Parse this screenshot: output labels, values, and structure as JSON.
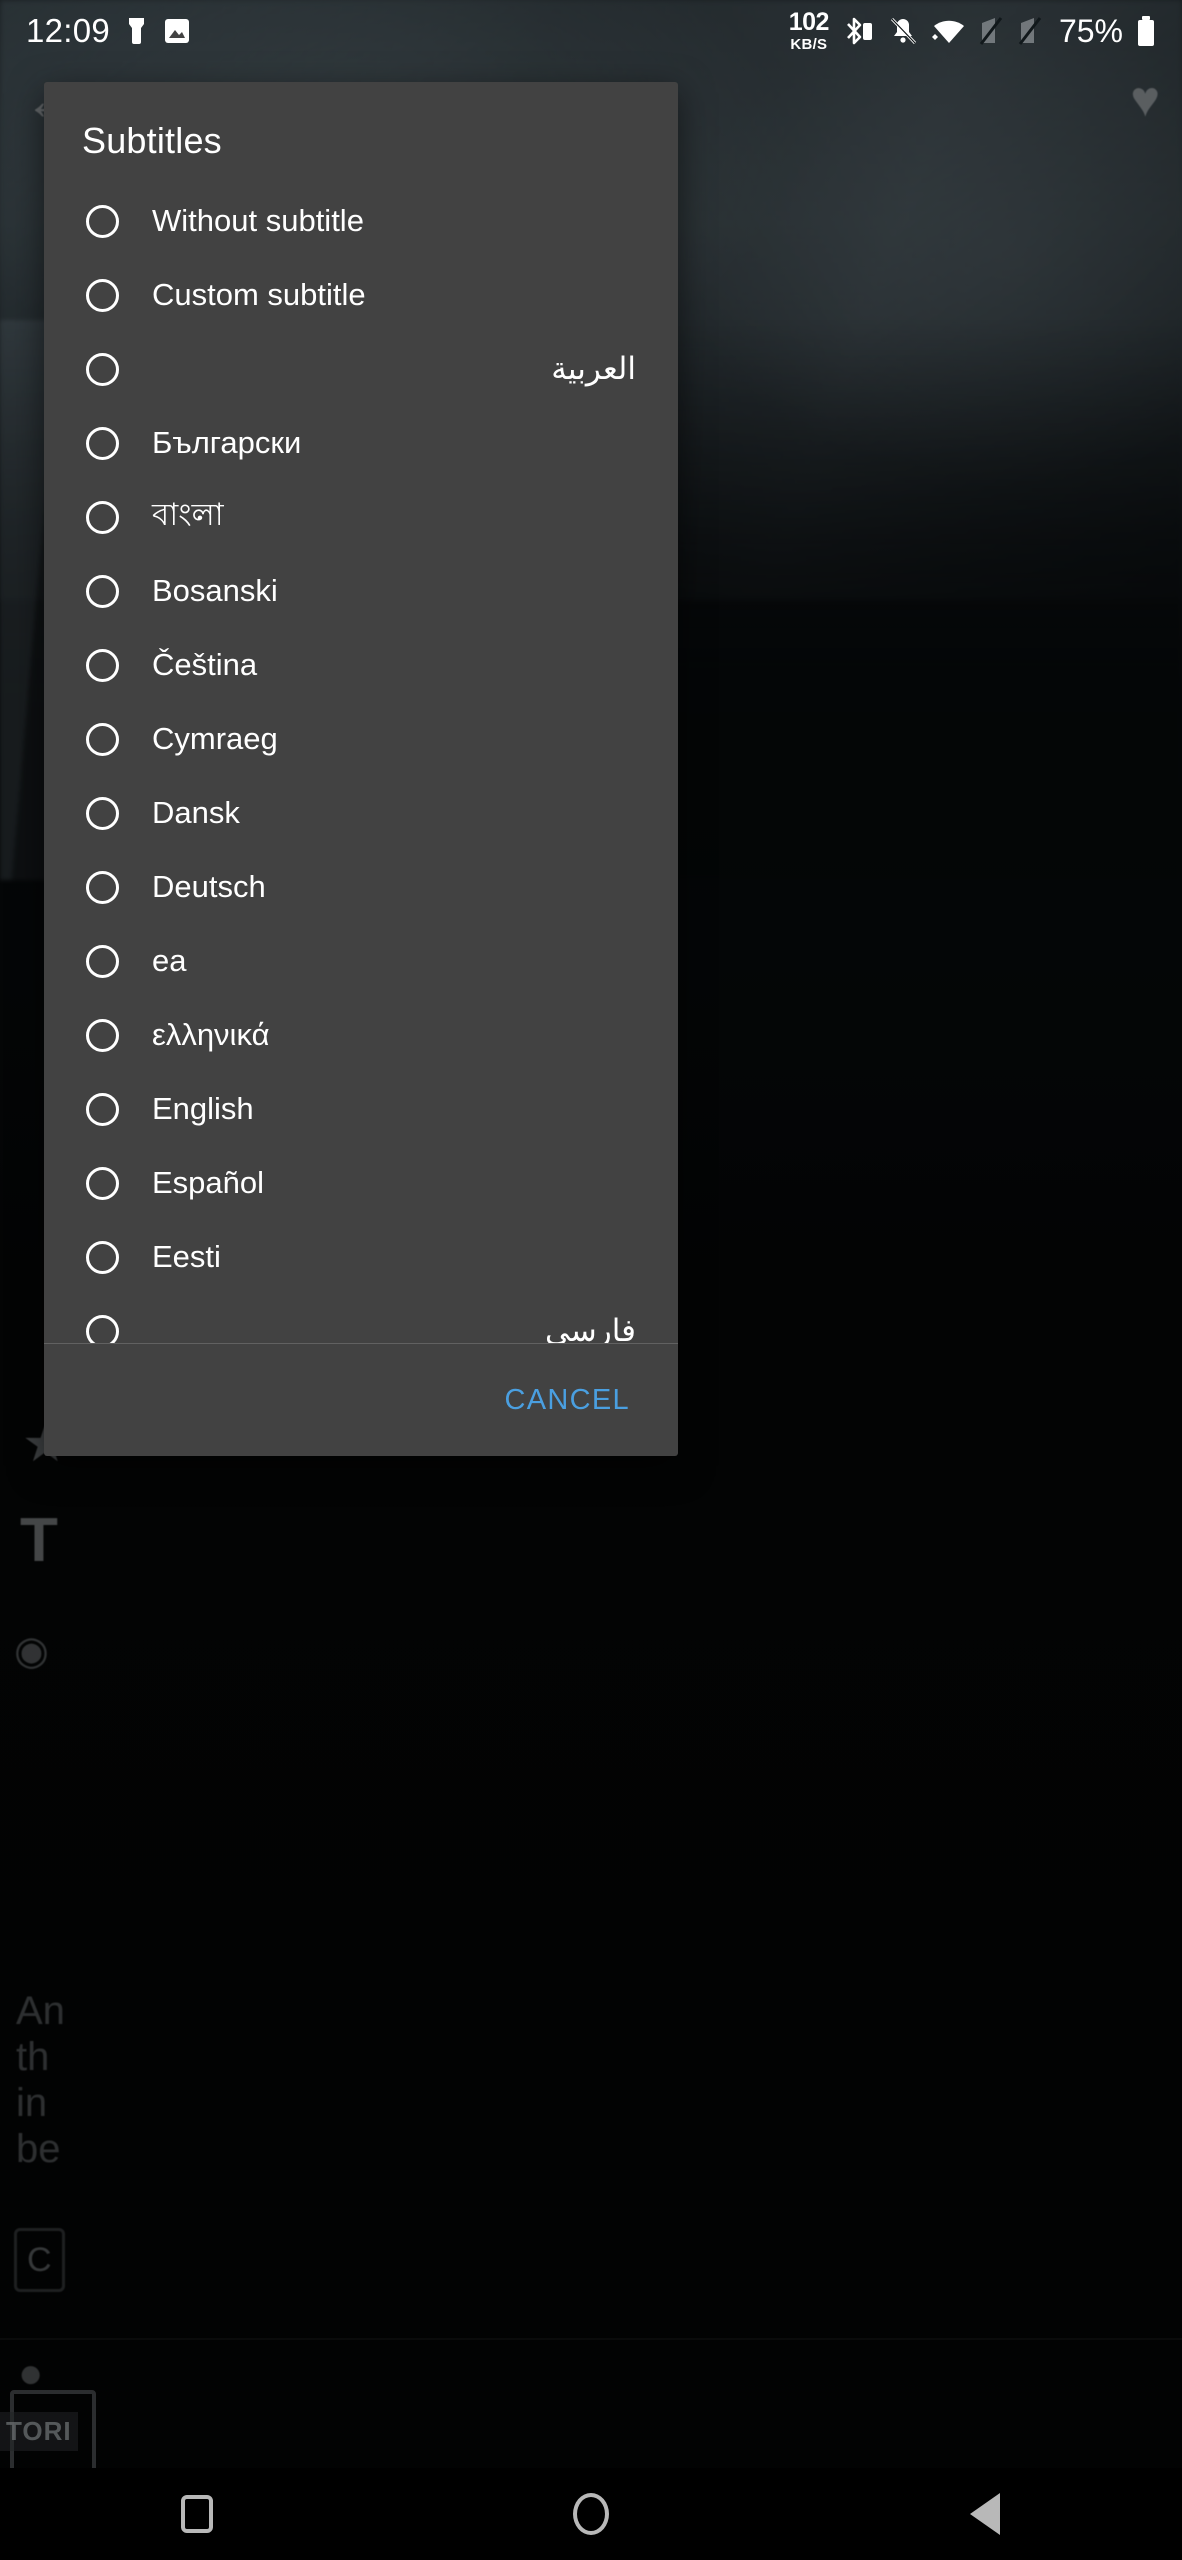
{
  "status_bar": {
    "clock": "12:09",
    "icons_left": [
      "app-notification-icon",
      "image-notification-icon"
    ],
    "network_speed_value": "102",
    "network_speed_unit": "KB/S",
    "icons_right": [
      "bluetooth-icon",
      "notifications-silenced-icon",
      "wifi-icon",
      "sim1-no-signal-icon",
      "sim2-no-signal-icon"
    ],
    "battery_percent": "75%"
  },
  "background": {
    "back_icon": "←",
    "heart_icon": "♥",
    "star_icon": "★",
    "title_letter": "T",
    "eye_icon": "◉",
    "paragraph": "An\nth\nin\nbe",
    "chip_text": "C",
    "person_icon": "●",
    "story_label": "TORI"
  },
  "dialog": {
    "title": "Subtitles",
    "items": [
      {
        "label": "Without subtitle",
        "selected": false,
        "rtl": false
      },
      {
        "label": "Custom subtitle",
        "selected": false,
        "rtl": false
      },
      {
        "label": "العربية",
        "selected": false,
        "rtl": true
      },
      {
        "label": "Български",
        "selected": false,
        "rtl": false
      },
      {
        "label": "বাংলা",
        "selected": false,
        "rtl": false
      },
      {
        "label": "Bosanski",
        "selected": false,
        "rtl": false
      },
      {
        "label": "Čeština",
        "selected": false,
        "rtl": false
      },
      {
        "label": "Cymraeg",
        "selected": false,
        "rtl": false
      },
      {
        "label": "Dansk",
        "selected": false,
        "rtl": false
      },
      {
        "label": "Deutsch",
        "selected": false,
        "rtl": false
      },
      {
        "label": "ea",
        "selected": false,
        "rtl": false
      },
      {
        "label": "ελληνικά",
        "selected": false,
        "rtl": false
      },
      {
        "label": "English",
        "selected": false,
        "rtl": false
      },
      {
        "label": "Español",
        "selected": false,
        "rtl": false
      },
      {
        "label": "Eesti",
        "selected": false,
        "rtl": false
      },
      {
        "label": "فارسی",
        "selected": false,
        "rtl": true
      }
    ],
    "cancel_label": "CANCEL",
    "accent_color": "#4a9fe0",
    "surface_color": "#424242"
  },
  "nav_bar": {
    "buttons": [
      {
        "name": "recents-button",
        "icon": "square-icon"
      },
      {
        "name": "home-button",
        "icon": "circle-icon"
      },
      {
        "name": "back-button",
        "icon": "triangle-left-icon"
      }
    ]
  }
}
